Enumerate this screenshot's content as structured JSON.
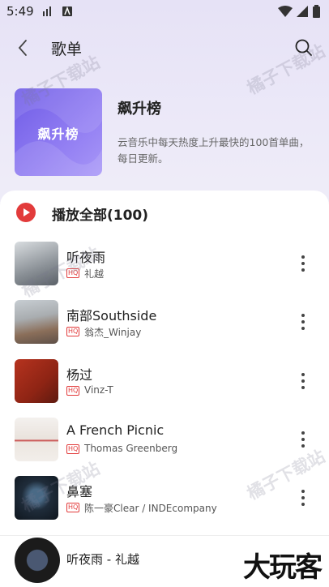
{
  "status": {
    "time": "5:49"
  },
  "header": {
    "title": "歌单"
  },
  "playlist": {
    "cover_text": "飙升榜",
    "name": "飙升榜",
    "description": "云音乐中每天热度上升最快的100首单曲，每日更新。"
  },
  "play_all": {
    "label": "播放全部(100)"
  },
  "badge": "HQ",
  "songs": [
    {
      "title": "听夜雨",
      "artist": "礼越"
    },
    {
      "title": "南部Southside",
      "artist": "翁杰_Winjay"
    },
    {
      "title": "杨过",
      "artist": "Vinz-T"
    },
    {
      "title": "A French Picnic",
      "artist": "Thomas Greenberg"
    },
    {
      "title": "鼻塞",
      "artist": "陈一豪Clear / INDEcompany"
    }
  ],
  "now_playing": {
    "text": "听夜雨 - 礼越"
  },
  "watermark": "橘子下载站",
  "brand_logo": "大玩客",
  "colors": {
    "accent": "#e23b3b",
    "cover": "#7b68ee"
  }
}
